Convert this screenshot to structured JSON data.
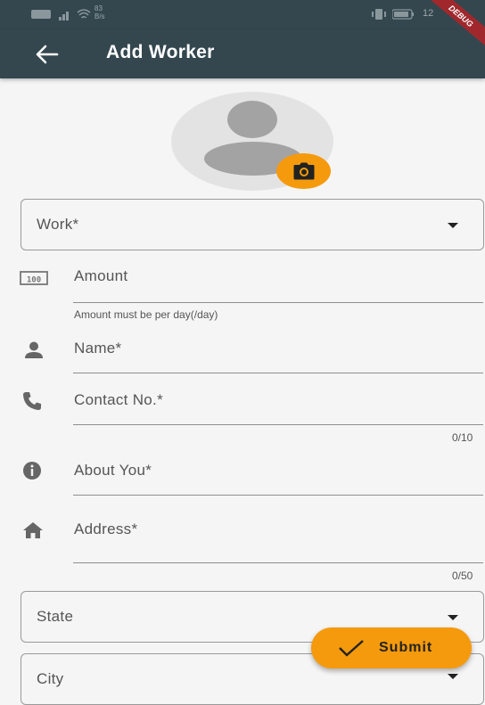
{
  "statusbar": {
    "speed": "83 B/s",
    "time": "12"
  },
  "debug_banner": "DEBUG",
  "appbar": {
    "title": "Add Worker",
    "back_icon": "arrow-back-icon"
  },
  "avatar": {
    "placeholder_icon": "person-placeholder-icon",
    "camera_icon": "camera-icon"
  },
  "form": {
    "work_label": "Work*",
    "amount_label": "Amount",
    "amount_helper": "Amount must be per day(/day)",
    "name_label": "Name*",
    "contact_label": "Contact No.*",
    "contact_counter": "0/10",
    "about_label": "About You*",
    "address_label": "Address*",
    "address_counter": "0/50",
    "state_label": "State",
    "city_label": "City"
  },
  "submit": {
    "label": "Submit",
    "icon": "check-icon"
  },
  "colors": {
    "appbar": "#34474f",
    "accent": "#f59a0c",
    "background": "#f5f5f5"
  }
}
